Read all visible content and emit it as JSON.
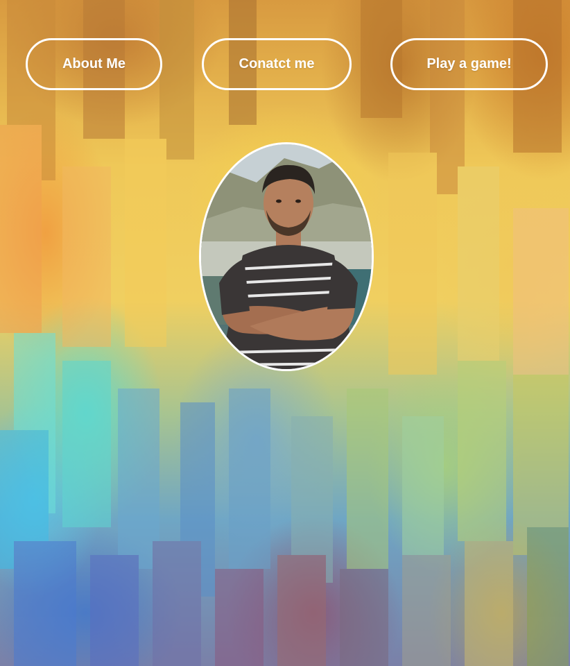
{
  "nav": {
    "about_label": "About Me",
    "contact_label": "Conatct me",
    "game_label": "Play a game!"
  },
  "profile": {
    "photo_icon": "person-portrait"
  },
  "colors": {
    "button_border": "#ffffff",
    "button_text": "#ffffff"
  }
}
